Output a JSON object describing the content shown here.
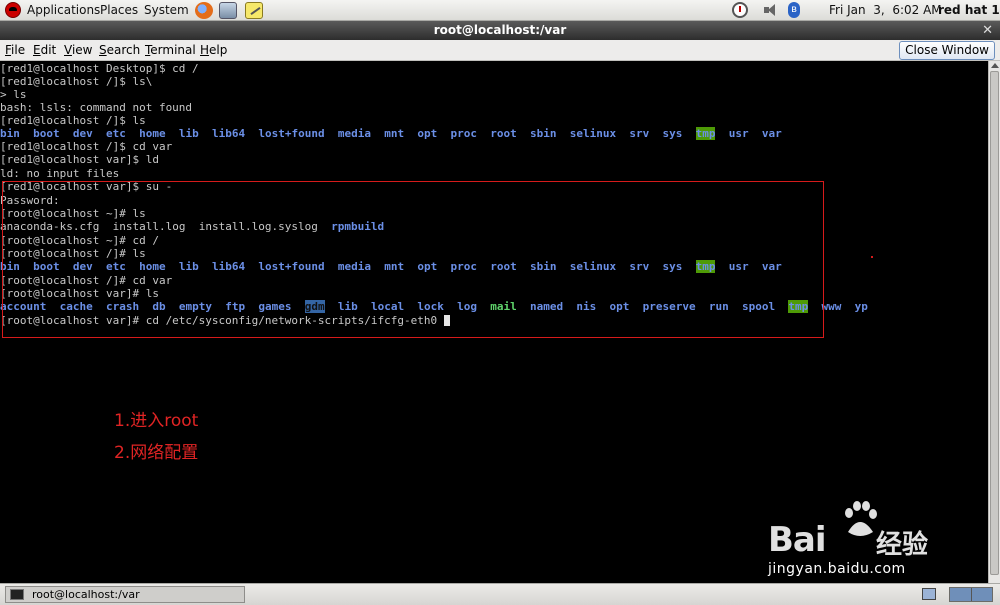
{
  "top_panel": {
    "menus": [
      "Applications",
      "Places",
      "System"
    ],
    "clock": "Fri Jan  3,  6:02 AM",
    "user": "red hat 1",
    "icons": [
      "redhat-logo",
      "firefox-icon",
      "network-icon",
      "notes-icon",
      "alarm-icon",
      "volume-icon",
      "bluetooth-icon"
    ]
  },
  "window": {
    "title": "root@localhost:/var",
    "close_window_label": "Close Window"
  },
  "menu_bar": {
    "items": [
      {
        "mnemonic": "F",
        "rest": "ile"
      },
      {
        "mnemonic": "E",
        "rest": "dit"
      },
      {
        "mnemonic": "V",
        "rest": "iew"
      },
      {
        "mnemonic": "S",
        "rest": "earch"
      },
      {
        "mnemonic": "T",
        "rest": "erminal"
      },
      {
        "mnemonic": "H",
        "rest": "elp"
      }
    ]
  },
  "terminal": {
    "lines": [
      "[red1@localhost Desktop]$ cd /",
      "[red1@localhost /]$ ls\\",
      "> ls",
      "bash: lsls: command not found",
      "[red1@localhost /]$ ls",
      "",
      "[red1@localhost /]$ cd var",
      "[red1@localhost var]$ ld",
      "ld: no input files",
      "[red1@localhost var]$ su -",
      "Password:",
      "[root@localhost ~]# ls",
      "",
      "[root@localhost ~]# cd /",
      "[root@localhost /]# ls",
      "",
      "[root@localhost /]# cd var",
      "[root@localhost var]# ls",
      "",
      "[root@localhost var]# cd /etc/sysconfig/network-scripts/ifcfg-eth0 "
    ],
    "root_listing": [
      {
        "name": "bin",
        "type": "dir"
      },
      {
        "name": "boot",
        "type": "dir"
      },
      {
        "name": "dev",
        "type": "dir"
      },
      {
        "name": "etc",
        "type": "dir"
      },
      {
        "name": "home",
        "type": "dir"
      },
      {
        "name": "lib",
        "type": "dir"
      },
      {
        "name": "lib64",
        "type": "dir"
      },
      {
        "name": "lost+found",
        "type": "dir"
      },
      {
        "name": "media",
        "type": "dir"
      },
      {
        "name": "mnt",
        "type": "dir"
      },
      {
        "name": "opt",
        "type": "dir"
      },
      {
        "name": "proc",
        "type": "dir"
      },
      {
        "name": "root",
        "type": "dir"
      },
      {
        "name": "sbin",
        "type": "dir"
      },
      {
        "name": "selinux",
        "type": "dir"
      },
      {
        "name": "srv",
        "type": "dir"
      },
      {
        "name": "sys",
        "type": "dir"
      },
      {
        "name": "tmp",
        "type": "tmp"
      },
      {
        "name": "usr",
        "type": "dir"
      },
      {
        "name": "var",
        "type": "dir"
      }
    ],
    "home_listing": [
      {
        "name": "anaconda-ks.cfg",
        "type": "file"
      },
      {
        "name": "install.log",
        "type": "file"
      },
      {
        "name": "install.log.syslog",
        "type": "file"
      },
      {
        "name": "rpmbuild",
        "type": "dir"
      }
    ],
    "var_listing": [
      {
        "name": "account",
        "type": "dir"
      },
      {
        "name": "cache",
        "type": "dir"
      },
      {
        "name": "crash",
        "type": "dir"
      },
      {
        "name": "db",
        "type": "dir"
      },
      {
        "name": "empty",
        "type": "dir"
      },
      {
        "name": "ftp",
        "type": "dir"
      },
      {
        "name": "games",
        "type": "dir"
      },
      {
        "name": "gdm",
        "type": "gdm"
      },
      {
        "name": "lib",
        "type": "dir"
      },
      {
        "name": "local",
        "type": "dir"
      },
      {
        "name": "lock",
        "type": "dir"
      },
      {
        "name": "log",
        "type": "dir"
      },
      {
        "name": "mail",
        "type": "exe"
      },
      {
        "name": "named",
        "type": "dir"
      },
      {
        "name": "nis",
        "type": "dir"
      },
      {
        "name": "opt",
        "type": "dir"
      },
      {
        "name": "preserve",
        "type": "dir"
      },
      {
        "name": "run",
        "type": "dir"
      },
      {
        "name": "spool",
        "type": "dir"
      },
      {
        "name": "tmp",
        "type": "tmp"
      },
      {
        "name": "www",
        "type": "dir"
      },
      {
        "name": "yp",
        "type": "dir"
      }
    ]
  },
  "annotations": [
    "1.进入root",
    "2.网络配置"
  ],
  "watermark": {
    "text": "Bai",
    "cn": "经验",
    "url": "jingyan.baidu.com"
  },
  "taskbar": {
    "task_label": "root@localhost:/var"
  },
  "colors": {
    "directory": "#6b8fe6",
    "annotation": "#e02424",
    "tmp_highlight": "#4e9a06"
  }
}
